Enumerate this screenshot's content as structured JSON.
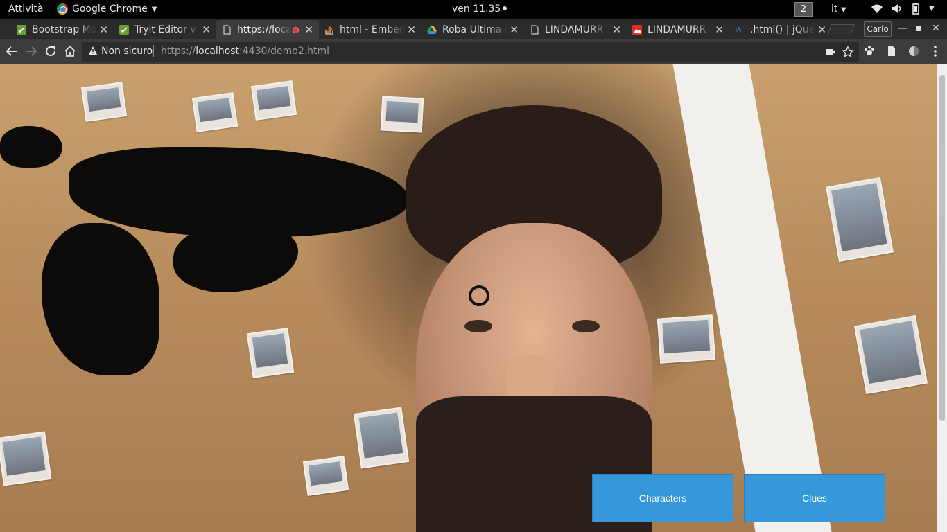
{
  "system_bar": {
    "activities": "Attività",
    "app_name": "Google Chrome",
    "clock": "ven 11.35",
    "workspace": "2",
    "language": "it"
  },
  "tabs": [
    {
      "title": "Bootstrap Mo",
      "icon": "bootstrap-favicon"
    },
    {
      "title": "Tryit Editor v",
      "icon": "tryit-favicon"
    },
    {
      "title": "https://loca",
      "icon": "page-favicon",
      "active": true,
      "recording": true
    },
    {
      "title": "html - Embed",
      "icon": "stackoverflow-favicon"
    },
    {
      "title": "Roba Ultima g",
      "icon": "drive-favicon"
    },
    {
      "title": "LINDAMURR",
      "icon": "page-favicon"
    },
    {
      "title": "LINDAMURR",
      "icon": "image-favicon"
    },
    {
      "title": ".html() | jQue",
      "icon": "jquery-favicon"
    }
  ],
  "profile": "Carlo",
  "omnibox": {
    "security_label": "Non sicuro",
    "url_protocol": "https",
    "url_host": "localhost",
    "url_rest": ":4430/demo2.html"
  },
  "page": {
    "characters_button": "Characters",
    "clues_button": "Clues"
  },
  "colors": {
    "button_blue": "#3498db",
    "chrome_dark": "#3c3c3c"
  }
}
